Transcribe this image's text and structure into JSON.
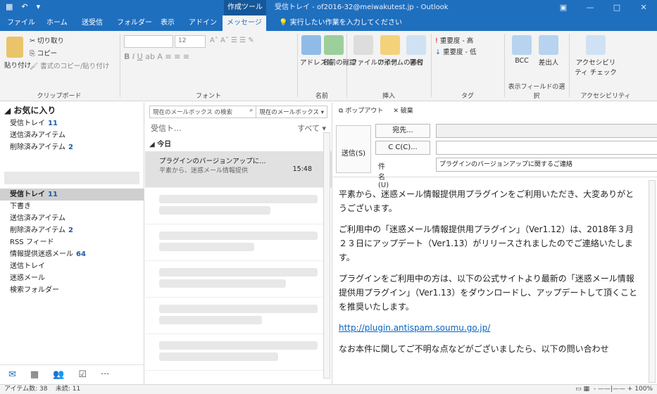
{
  "titlebar": {
    "context_tools": "作成ツール",
    "title": "受信トレイ - of2016-32@meiwakutest.jp - Outlook"
  },
  "tabs": [
    "ファイル",
    "ホーム",
    "送受信",
    "フォルダー",
    "表示",
    "アドイン",
    "メッセージ"
  ],
  "tell_me": "実行したい作業を入力してください",
  "ribbon": {
    "clipboard": {
      "paste": "貼り付け",
      "cut": "切り取り",
      "copy": "コピー",
      "painter": "書式のコピー/貼り付け",
      "label": "クリップボード"
    },
    "font": {
      "size": "12",
      "label": "フォント"
    },
    "names": {
      "address_book": "アドレス帳",
      "check_names": "名前の確認",
      "label": "名前"
    },
    "include": {
      "attach_file": "ファイルの添付",
      "attach_item": "アイテムの添付",
      "signature": "署名",
      "label": "挿入"
    },
    "tags": {
      "high": "重要度 - 高",
      "low": "重要度 - 低",
      "label": "タグ"
    },
    "fields": {
      "bcc": "BCC",
      "from": "差出人",
      "label": "表示フィールドの選択"
    },
    "access": {
      "check": "アクセシビリティ チェック",
      "label": "アクセシビリティ"
    }
  },
  "nav": {
    "favorites_header": "お気に入り",
    "favorites": [
      {
        "label": "受信トレイ",
        "count": "11"
      },
      {
        "label": "送信済みアイテム",
        "count": ""
      },
      {
        "label": "削除済みアイテム",
        "count": "2"
      }
    ],
    "folders": [
      {
        "label": "受信トレイ",
        "count": "11"
      },
      {
        "label": "下書き",
        "count": ""
      },
      {
        "label": "送信済みアイテム",
        "count": ""
      },
      {
        "label": "削除済みアイテム",
        "count": "2"
      },
      {
        "label": "RSS フィード",
        "count": ""
      },
      {
        "label": "情報提供迷惑メール",
        "count": "64"
      },
      {
        "label": "送信トレイ",
        "count": ""
      },
      {
        "label": "迷惑メール",
        "count": ""
      },
      {
        "label": "検索フォルダー",
        "count": ""
      }
    ]
  },
  "list": {
    "search_placeholder": "現在のメールボックス の検索",
    "scope": "現在のメールボックス",
    "folder": "受信ト...",
    "filter": "すべて",
    "group_today": "今日",
    "selected": {
      "subject": "プラグインのバージョンアップに...",
      "preview": "平素から、迷惑メール情報提供",
      "time": "15:48"
    }
  },
  "compose": {
    "popout": "ポップアウト",
    "discard": "破棄",
    "send": "送信(S)",
    "to": "宛先...",
    "cc": "C C(C)...",
    "subject_label": "件名(U)",
    "subject": "プラグインのバージョンアップに関するご連絡",
    "body": [
      "平素から、迷惑メール情報提供用プラグインをご利用いただき、大変ありがとうございます。",
      "ご利用中の「迷惑メール情報提供用プラグイン」（Ver1.12）は、2018年３月２３日にアップデート（Ver1.13）がリリースされましたのでご連絡いたします。",
      "プラグインをご利用中の方は、以下の公式サイトより最新の「迷惑メール情報提供用プラグイン」（Ver1.13）をダウンロードし、アップデートして頂くことを推奨いたします。",
      "http://plugin.antispam.soumu.go.jp/",
      "なお本件に関してご不明な点などがございましたら、以下の問い合わせ"
    ]
  },
  "status": {
    "items": "アイテム数: 38",
    "unread": "未読: 11",
    "zoom": "100%"
  }
}
